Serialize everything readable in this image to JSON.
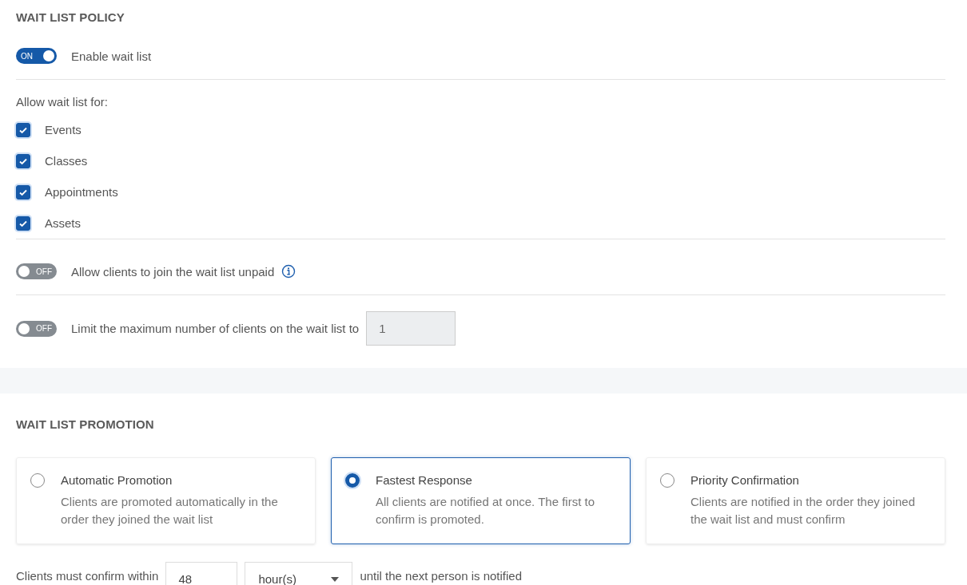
{
  "policy": {
    "title": "WAIT LIST POLICY",
    "enable": {
      "on": true,
      "toggle_text": "ON",
      "label": "Enable wait list"
    },
    "allow_label": "Allow wait list for:",
    "types": [
      {
        "label": "Events",
        "checked": true
      },
      {
        "label": "Classes",
        "checked": true
      },
      {
        "label": "Appointments",
        "checked": true
      },
      {
        "label": "Assets",
        "checked": true
      }
    ],
    "unpaid": {
      "on": false,
      "toggle_text": "OFF",
      "label": "Allow clients to join the wait list unpaid"
    },
    "limit": {
      "on": false,
      "toggle_text": "OFF",
      "label": "Limit the maximum number of clients on the wait list to",
      "value": "1",
      "disabled": true
    }
  },
  "promotion": {
    "title": "WAIT LIST PROMOTION",
    "options": [
      {
        "title": "Automatic Promotion",
        "description": "Clients are promoted automatically in the order they joined the wait list",
        "selected": false
      },
      {
        "title": "Fastest Response",
        "description": "All clients are notified at once. The first to confirm is promoted.",
        "selected": true
      },
      {
        "title": "Priority Confirmation",
        "description": "Clients are notified in the order they joined the wait list and must confirm",
        "selected": false
      }
    ],
    "confirm": {
      "prefix": "Clients must confirm within",
      "value": "48",
      "unit": "hour(s)",
      "suffix": "until the next person is notified"
    }
  }
}
